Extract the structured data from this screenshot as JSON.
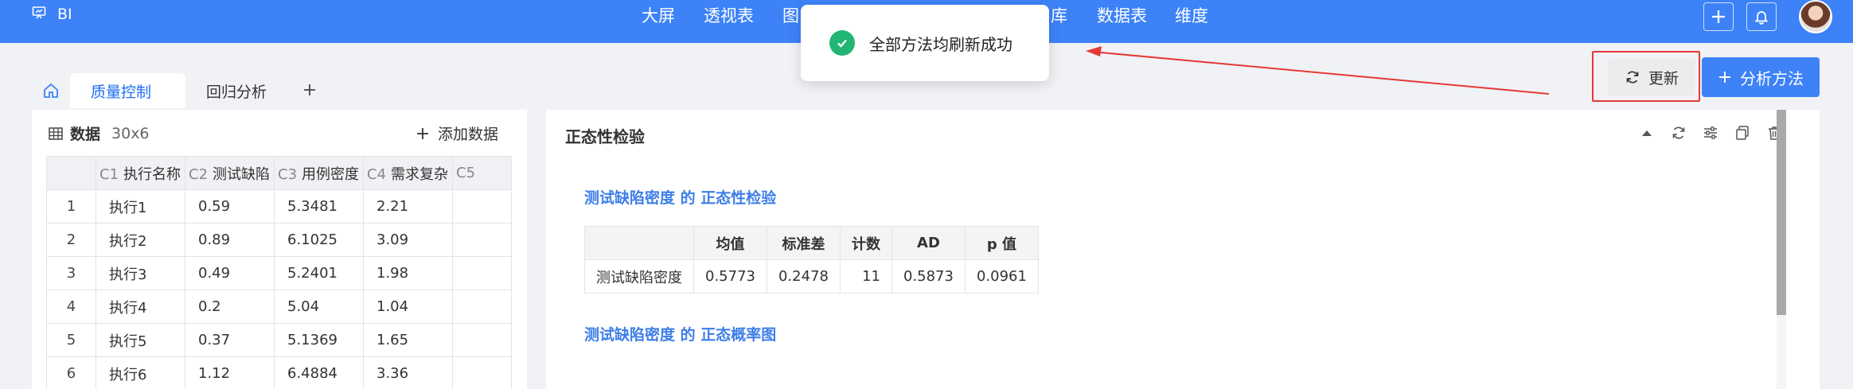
{
  "app": {
    "brand_label": "BI",
    "brand_icon": "presentation-icon"
  },
  "top_nav": [
    "大屏",
    "透视表",
    "图",
    "库",
    "数据表",
    "维度"
  ],
  "tabs": [
    {
      "label": "质量控制",
      "active": true
    },
    {
      "label": "回归分析",
      "active": false
    }
  ],
  "toast": {
    "message": "全部方法均刷新成功",
    "icon": "check-circle-icon"
  },
  "actions": {
    "update_label": "更新",
    "add_method_label": "分析方法"
  },
  "colors": {
    "accent": "#3d82f7",
    "success": "#22b573",
    "highlight": "#e53935",
    "section_title": "#3d7ee8"
  },
  "data_panel": {
    "title": "数据",
    "dims": "30x6",
    "add_label": "添加数据",
    "columns": [
      {
        "code": "C1",
        "name": "执行名称"
      },
      {
        "code": "C2",
        "name": "测试缺陷"
      },
      {
        "code": "C3",
        "name": "用例密度"
      },
      {
        "code": "C4",
        "name": "需求复杂"
      },
      {
        "code": "C5",
        "name": ""
      }
    ],
    "rows": [
      [
        "1",
        "执行1",
        "0.59",
        "5.3481",
        "2.21",
        ""
      ],
      [
        "2",
        "执行2",
        "0.89",
        "6.1025",
        "3.09",
        ""
      ],
      [
        "3",
        "执行3",
        "0.49",
        "5.2401",
        "1.98",
        ""
      ],
      [
        "4",
        "执行4",
        "0.2",
        "5.04",
        "1.04",
        ""
      ],
      [
        "5",
        "执行5",
        "0.37",
        "5.1369",
        "1.65",
        ""
      ],
      [
        "6",
        "执行6",
        "1.12",
        "6.4884",
        "3.36",
        ""
      ]
    ]
  },
  "result_panel": {
    "title": "正态性检验",
    "section1_title": "测试缺陷密度 的 正态性检验",
    "section2_title": "测试缺陷密度 的 正态概率图",
    "stats_headers": [
      "",
      "均值",
      "标准差",
      "计数",
      "AD",
      "p 值"
    ],
    "stats_row": [
      "测试缺陷密度",
      "0.5773",
      "0.2478",
      "11",
      "0.5873",
      "0.0961"
    ]
  }
}
